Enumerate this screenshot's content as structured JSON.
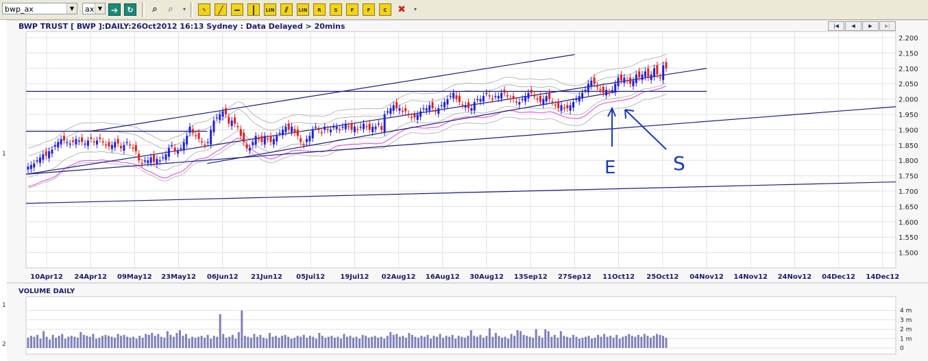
{
  "toolbar": {
    "symbol_value": "bwp_ax",
    "exchange_value": "ax",
    "yellow_buttons": [
      "LIN",
      "LIN",
      "R",
      "S",
      "F",
      "F",
      "C"
    ],
    "nav_buttons": [
      "|◀",
      "◀",
      "▶",
      "▶|"
    ]
  },
  "chart_data": [
    {
      "type": "candlestick",
      "title": "BWP TRUST [ BWP ]:DAILY:26Oct2012 16:13 Sydney : Data Delayed > 20mins",
      "ylim": [
        1.45,
        2.22
      ],
      "y_ticks": [
        "2.200",
        "2.150",
        "2.100",
        "2.050",
        "2.000",
        "1.950",
        "1.900",
        "1.850",
        "1.800",
        "1.750",
        "1.700",
        "1.650",
        "1.600",
        "1.550",
        "1.500"
      ],
      "x_ticks": [
        "10Apr12",
        "24Apr12",
        "09May12",
        "23May12",
        "06Jun12",
        "21Jun12",
        "05Jul12",
        "19Jul12",
        "02Aug12",
        "16Aug12",
        "30Aug12",
        "13Sep12",
        "27Sep12",
        "11Oct12",
        "25Oct12",
        "04Nov12",
        "14Nov12",
        "24Nov12",
        "04Dec12",
        "14Dec12"
      ],
      "left_marker": "1",
      "close_series": [
        1.78,
        1.785,
        1.79,
        1.8,
        1.81,
        1.82,
        1.815,
        1.83,
        1.835,
        1.85,
        1.86,
        1.87,
        1.865,
        1.86,
        1.855,
        1.86,
        1.87,
        1.865,
        1.86,
        1.855,
        1.865,
        1.87,
        1.86,
        1.865,
        1.87,
        1.86,
        1.85,
        1.845,
        1.85,
        1.86,
        1.855,
        1.84,
        1.85,
        1.86,
        1.85,
        1.84,
        1.83,
        1.8,
        1.79,
        1.8,
        1.8,
        1.81,
        1.795,
        1.805,
        1.8,
        1.81,
        1.82,
        1.84,
        1.85,
        1.83,
        1.83,
        1.84,
        1.86,
        1.88,
        1.91,
        1.89,
        1.88,
        1.87,
        1.86,
        1.85,
        1.86,
        1.9,
        1.93,
        1.94,
        1.95,
        1.96,
        1.95,
        1.92,
        1.93,
        1.92,
        1.91,
        1.88,
        1.86,
        1.84,
        1.84,
        1.86,
        1.88,
        1.87,
        1.86,
        1.88,
        1.87,
        1.86,
        1.87,
        1.88,
        1.89,
        1.9,
        1.91,
        1.9,
        1.91,
        1.89,
        1.88,
        1.86,
        1.85,
        1.87,
        1.88,
        1.9,
        1.91,
        1.9,
        1.89,
        1.91,
        1.9,
        1.9,
        1.91,
        1.91,
        1.9,
        1.91,
        1.92,
        1.91,
        1.9,
        1.91,
        1.9,
        1.91,
        1.92,
        1.91,
        1.9,
        1.91,
        1.91,
        1.92,
        1.9,
        1.95,
        1.96,
        1.97,
        1.98,
        1.97,
        1.97,
        1.96,
        1.96,
        1.95,
        1.94,
        1.94,
        1.95,
        1.96,
        1.97,
        1.97,
        1.98,
        1.97,
        1.96,
        1.97,
        1.98,
        1.99,
        2.0,
        2.01,
        2.02,
        2.0,
        1.99,
        1.98,
        1.98,
        1.97,
        1.97,
        1.99,
        2.0,
        2.0,
        2.01,
        2.02,
        2.01,
        2.0,
        2.01,
        2.01,
        2.02,
        2.02,
        2.01,
        2.0,
        2.0,
        1.99,
        1.99,
        2.0,
        2.01,
        2.02,
        2.02,
        2.01,
        2.0,
        1.99,
        2.0,
        2.01,
        2.0,
        1.99,
        1.98,
        1.97,
        1.98,
        1.97,
        1.97,
        1.98,
        1.99,
        2.0,
        2.01,
        2.02,
        2.03,
        2.05,
        2.06,
        2.05,
        2.04,
        2.03,
        2.02,
        2.03,
        2.02,
        2.03,
        2.05,
        2.07,
        2.06,
        2.07,
        2.06,
        2.05,
        2.06,
        2.08,
        2.07,
        2.08,
        2.09,
        2.07,
        2.08,
        2.1,
        2.08,
        2.07,
        2.11,
        2.1
      ],
      "trendlines": [
        {
          "from": [
            "10Apr12",
            1.755
          ],
          "to": [
            "04Nov12",
            2.1
          ]
        },
        {
          "from": [
            "24Apr12",
            1.895
          ],
          "to": [
            "27Sep12",
            2.145
          ]
        },
        {
          "from": [
            "01Jun12",
            1.79
          ],
          "to": [
            "11Oct12",
            2.025
          ]
        },
        {
          "from": [
            "10Apr12",
            1.66
          ],
          "to": [
            "14Dec12",
            1.73
          ]
        },
        {
          "from": [
            "10Apr12",
            1.755
          ],
          "to": [
            "14Dec12",
            1.975
          ]
        },
        {
          "from": [
            "10Apr12",
            2.025
          ],
          "to": [
            "04Nov12",
            2.025
          ]
        },
        {
          "from": [
            "10Apr12",
            1.895
          ],
          "to": [
            "01Jun12",
            1.895
          ]
        }
      ],
      "annotations": [
        "E",
        "S"
      ]
    },
    {
      "type": "bar",
      "title": "VOLUME DAILY",
      "y_ticks": [
        "4 m",
        "3 m",
        "2 m",
        "1 m",
        "0"
      ],
      "left_markers": [
        "1",
        "2"
      ],
      "values": [
        1.1,
        1.3,
        1.2,
        1.4,
        1.0,
        1.8,
        1.2,
        0.9,
        1.4,
        1.1,
        1.3,
        1.5,
        1.0,
        1.2,
        1.3,
        1.2,
        1.1,
        1.7,
        1.4,
        1.3,
        1.2,
        1.5,
        1.0,
        1.1,
        1.3,
        1.4,
        1.3,
        1.2,
        1.1,
        1.5,
        1.3,
        1.4,
        1.2,
        1.1,
        1.2,
        1.0,
        1.3,
        1.1,
        1.5,
        1.4,
        1.6,
        1.3,
        1.5,
        1.2,
        1.1,
        1.8,
        1.4,
        1.2,
        1.6,
        1.9,
        1.3,
        1.5,
        1.0,
        1.2,
        1.1,
        1.2,
        1.3,
        1.1,
        1.4,
        1.0,
        1.3,
        1.2,
        3.6,
        1.5,
        1.1,
        1.2,
        1.4,
        1.0,
        1.7,
        4.0,
        1.3,
        1.2,
        1.1,
        1.5,
        1.2,
        1.4,
        1.1,
        1.0,
        1.6,
        1.2,
        1.3,
        1.1,
        1.3,
        1.4,
        1.2,
        1.0,
        1.1,
        1.3,
        1.2,
        1.4,
        1.1,
        1.3,
        1.2,
        1.0,
        1.6,
        1.3,
        1.1,
        1.2,
        1.3,
        1.1,
        1.2,
        1.0,
        1.5,
        1.2,
        1.3,
        1.1,
        1.2,
        1.0,
        1.4,
        1.3,
        1.1,
        1.2,
        1.3,
        1.1,
        1.2,
        1.0,
        1.3,
        1.7,
        1.4,
        1.5,
        1.2,
        1.3,
        1.1,
        1.6,
        1.4,
        1.2,
        1.1,
        1.3,
        1.2,
        1.4,
        1.0,
        1.3,
        1.2,
        1.5,
        1.1,
        1.3,
        1.2,
        1.4,
        1.0,
        1.3,
        1.2,
        1.1,
        1.3,
        1.9,
        1.3,
        1.2,
        1.4,
        1.1,
        1.3,
        2.1,
        1.2,
        1.6,
        1.3,
        1.1,
        1.2,
        1.0,
        1.5,
        1.3,
        1.9,
        1.8,
        1.4,
        1.3,
        1.2,
        1.1,
        2.0,
        1.3,
        1.1,
        2.0,
        1.8,
        1.2,
        1.4,
        1.1,
        1.8,
        1.3,
        1.2,
        1.1,
        1.4,
        1.2,
        1.0,
        1.1,
        1.2,
        1.3,
        1.0,
        1.1,
        1.4,
        1.2,
        1.5,
        1.2,
        1.3,
        1.1,
        1.4,
        1.0,
        1.2,
        1.3,
        1.5,
        1.3,
        1.2,
        1.4,
        1.2,
        1.5,
        1.3,
        1.1,
        1.3,
        1.5,
        1.4,
        1.3,
        1.1
      ]
    }
  ],
  "colors": {
    "up_candle": "#2020e0",
    "down_candle": "#e02020",
    "trendline": "#1c1c7a",
    "bollinger": "#b8b8b8",
    "moving_average": "#e060e0",
    "volume_bar": "#8080b8",
    "grid": "#e0e0e0"
  }
}
